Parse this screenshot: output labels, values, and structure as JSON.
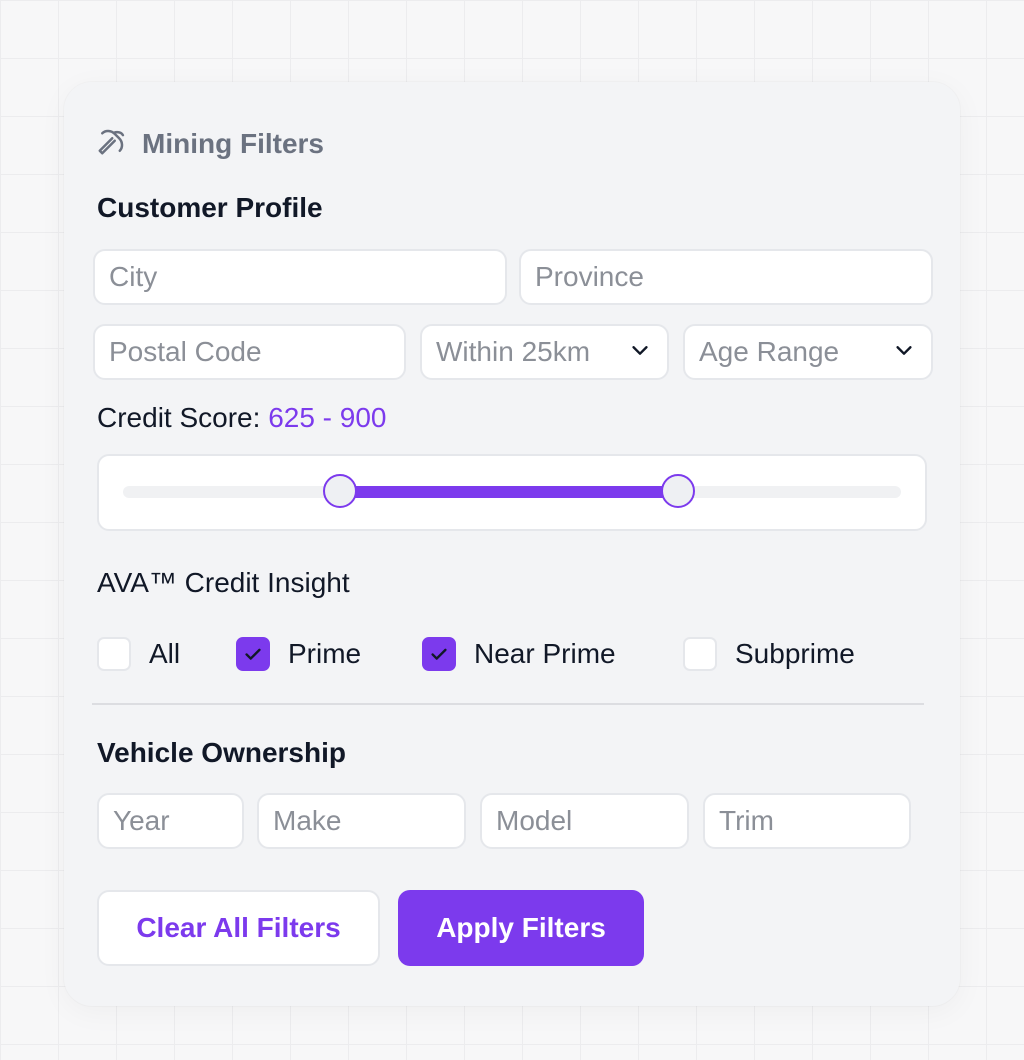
{
  "header": {
    "title": "Mining Filters",
    "icon": "pickaxe-icon"
  },
  "customer_profile": {
    "title": "Customer Profile",
    "city_placeholder": "City",
    "province_placeholder": "Province",
    "postal_placeholder": "Postal Code",
    "distance_selected": "Within 25km",
    "age_selected": "Age Range"
  },
  "credit_score": {
    "label": "Credit Score:",
    "range_text": "625 - 900",
    "min_value": 625,
    "max_value": 900,
    "low_fraction": 0.279,
    "high_fraction": 0.714
  },
  "insight": {
    "title": "AVA™ Credit Insight",
    "options": [
      {
        "label": "All",
        "checked": false
      },
      {
        "label": "Prime",
        "checked": true
      },
      {
        "label": "Near Prime",
        "checked": true
      },
      {
        "label": "Subprime",
        "checked": false
      }
    ]
  },
  "vehicle": {
    "title": "Vehicle Ownership",
    "year_placeholder": "Year",
    "make_placeholder": "Make",
    "model_placeholder": "Model",
    "trim_placeholder": "Trim"
  },
  "actions": {
    "clear_label": "Clear All Filters",
    "apply_label": "Apply Filters"
  },
  "colors": {
    "accent": "#7c3aed",
    "text": "#111827",
    "muted": "#8b8f97"
  }
}
